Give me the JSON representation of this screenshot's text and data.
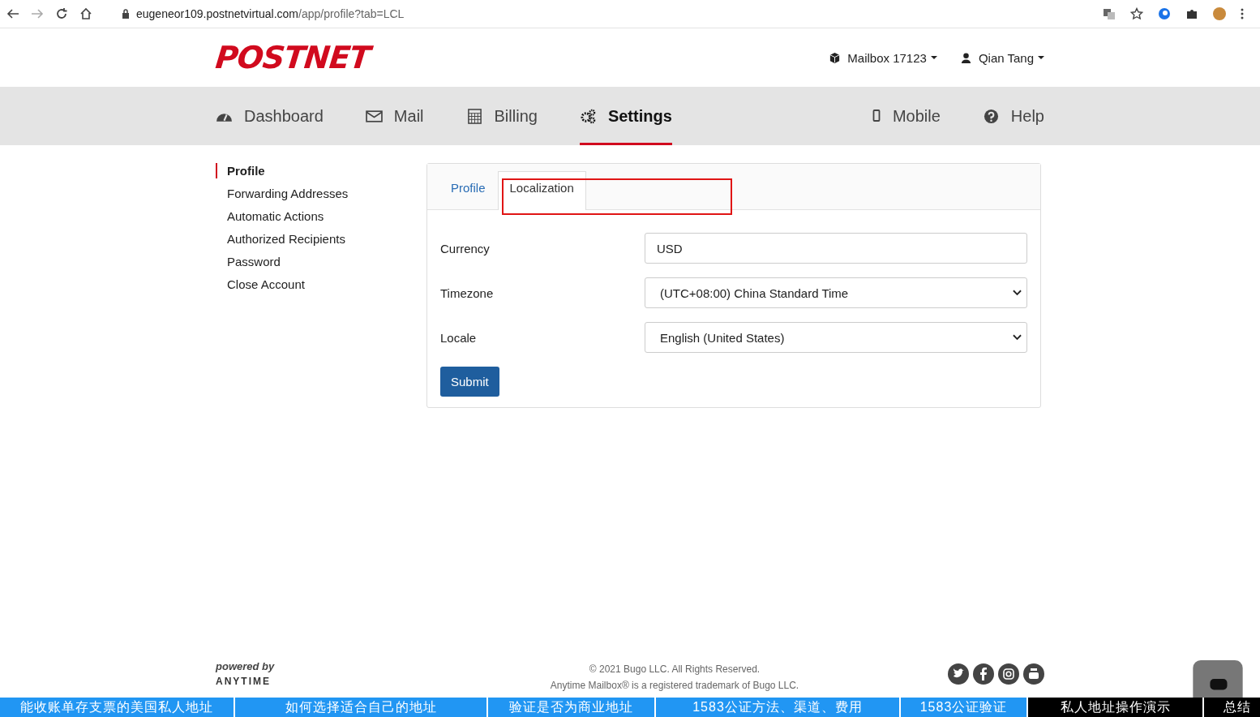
{
  "browser": {
    "url_host": "eugeneor109.postnetvirtual.com",
    "url_path": "/app/profile?tab=LCL"
  },
  "header": {
    "logo": "POSTNET",
    "mailbox": "Mailbox 17123",
    "user": "Qian Tang"
  },
  "nav": [
    {
      "label": "Dashboard",
      "selected": false
    },
    {
      "label": "Mail",
      "selected": false
    },
    {
      "label": "Billing",
      "selected": false
    },
    {
      "label": "Settings",
      "selected": true
    },
    {
      "label": "Mobile",
      "selected": false
    },
    {
      "label": "Help",
      "selected": false
    }
  ],
  "sidebar": {
    "items": [
      {
        "label": "Profile",
        "selected": true
      },
      {
        "label": "Forwarding Addresses",
        "selected": false
      },
      {
        "label": "Automatic Actions",
        "selected": false
      },
      {
        "label": "Authorized Recipients",
        "selected": false
      },
      {
        "label": "Password",
        "selected": false
      },
      {
        "label": "Close Account",
        "selected": false
      }
    ]
  },
  "tabs": [
    {
      "label": "Profile",
      "selected": false
    },
    {
      "label": "Localization",
      "selected": true
    }
  ],
  "form": {
    "fields": [
      {
        "label": "Currency",
        "kind": "text",
        "value": "USD"
      },
      {
        "label": "Timezone",
        "kind": "select",
        "value": "(UTC+08:00) China Standard Time"
      },
      {
        "label": "Locale",
        "kind": "select",
        "value": "English (United States)"
      }
    ],
    "submit": "Submit"
  },
  "footer": {
    "powered_by": "powered by",
    "brand": "ANYTIME",
    "copyright": "© 2021 Bugo LLC. All Rights Reserved.",
    "trademark": "Anytime Mailbox® is a registered trademark of Bugo LLC."
  },
  "chapters": [
    {
      "label": "能收账单存支票的美国私人地址",
      "color": "#2196f3"
    },
    {
      "label": "如何选择适合自己的地址",
      "color": "#2196f3"
    },
    {
      "label": "验证是否为商业地址",
      "color": "#2196f3"
    },
    {
      "label": "1583公证方法、渠道、费用",
      "color": "#2196f3"
    },
    {
      "label": "1583公证验证",
      "color": "#2196f3"
    },
    {
      "label": "私人地址操作演示",
      "color": "#000000"
    },
    {
      "label": "总结",
      "color": "#000000"
    }
  ]
}
